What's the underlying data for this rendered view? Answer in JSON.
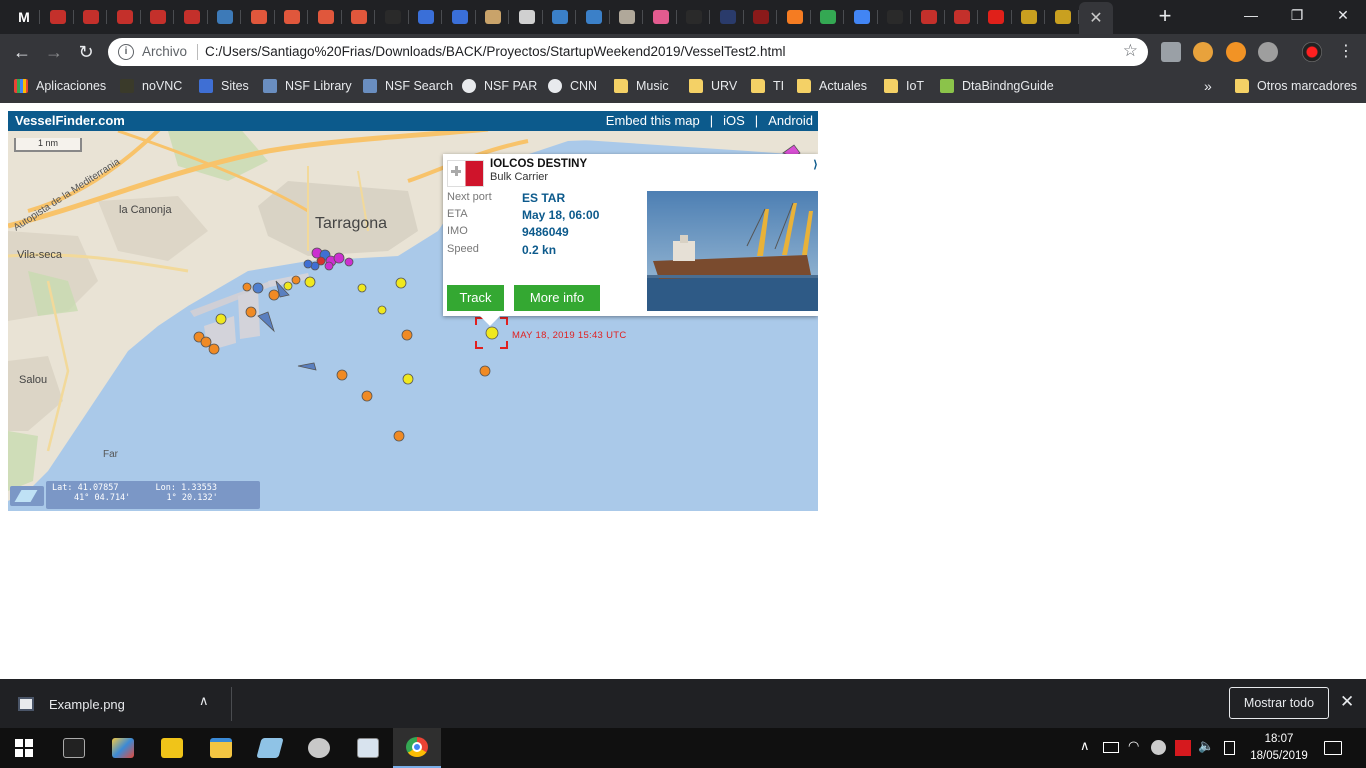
{
  "browser": {
    "active_tab_close": "✕",
    "new_tab": "+",
    "window": {
      "minimize": "—",
      "restore": "❐",
      "close": "✕"
    },
    "nav": {
      "back": "←",
      "forward": "→",
      "reload": "↻"
    },
    "omnibox": {
      "scheme": "Archivo",
      "url": "C:/Users/Santiago%20Frias/Downloads/BACK/Proyectos/StartupWeekend2019/VesselTest2.html",
      "star": "☆"
    },
    "tab_favicons": [
      {
        "letter": "M",
        "color": "#ffffff"
      },
      {
        "color": "#c4302b"
      },
      {
        "color": "#c4302b"
      },
      {
        "color": "#c4302b"
      },
      {
        "color": "#c4302b"
      },
      {
        "color": "#c4302b"
      },
      {
        "color": "#3d7ab8"
      },
      {
        "color": "#e0573c"
      },
      {
        "color": "#e0573c"
      },
      {
        "color": "#e0573c"
      },
      {
        "color": "#e0573c"
      },
      {
        "color": "#2a2a2a"
      },
      {
        "color": "#3a6fd8"
      },
      {
        "color": "#3a6fd8"
      },
      {
        "color": "#c9a36a"
      },
      {
        "color": "#d0d0d0"
      },
      {
        "color": "#3b80c8"
      },
      {
        "color": "#3b80c8"
      },
      {
        "color": "#b0a89a"
      },
      {
        "color": "#e35b8f"
      },
      {
        "color": "#2a2a2a"
      },
      {
        "color": "#2a3b6b"
      },
      {
        "color": "#8a1a1a"
      },
      {
        "color": "#f57c22"
      },
      {
        "color": "#34a853"
      },
      {
        "color": "#4285f4"
      },
      {
        "color": "#2a2a2a"
      },
      {
        "color": "#c4302b"
      },
      {
        "color": "#c4302b"
      },
      {
        "color": "#e0201a"
      },
      {
        "color": "#c9a020"
      },
      {
        "color": "#c9a020"
      }
    ]
  },
  "bookmarks": [
    {
      "label": "Aplicaciones",
      "icon": "grid"
    },
    {
      "label": "noVNC",
      "icon": "vnc"
    },
    {
      "label": "Sites",
      "icon": "sites"
    },
    {
      "label": "NSF Library",
      "icon": "nsf"
    },
    {
      "label": "NSF Search",
      "icon": "nsf"
    },
    {
      "label": "NSF PAR",
      "icon": "globe"
    },
    {
      "label": "CNN",
      "icon": "globe"
    },
    {
      "label": "Music",
      "icon": "folder"
    },
    {
      "label": "URV",
      "icon": "folder"
    },
    {
      "label": "TI",
      "icon": "folder"
    },
    {
      "label": "Actuales",
      "icon": "folder"
    },
    {
      "label": "IoT",
      "icon": "folder"
    },
    {
      "label": "DtaBindngGuide",
      "icon": "android"
    }
  ],
  "bookmarks_more": "»",
  "bookmarks_other": "Otros marcadores",
  "map": {
    "brand": "VesselFinder.com",
    "links": [
      "Embed this map",
      "iOS",
      "Android"
    ],
    "link_separator": "|",
    "scale": "1 nm",
    "places": {
      "city": "Tarragona",
      "canonja": "la Canonja",
      "vilaseca": "Vila-seca",
      "salou": "Salou",
      "far": "Far",
      "motorway": "Autopista de la Mediterrania"
    },
    "coords": {
      "lat_label": "Lat: 41.07857",
      "lon_label": "Lon: 1.33553",
      "lat_dms": "41° 04.714'",
      "lon_dms": "1° 20.132'"
    },
    "popup": {
      "name": "IOLCOS DESTINY",
      "type": "Bulk Carrier",
      "next_port_label": "Next port",
      "next_port": "ES TAR",
      "eta_label": "ETA",
      "eta": "May 18, 06:00",
      "imo_label": "IMO",
      "imo": "9486049",
      "speed_label": "Speed",
      "speed": "0.2 kn",
      "track": "Track",
      "more_info": "More info"
    },
    "timestamp": "MAY 18, 2019 15:43 UTC"
  },
  "downloads": {
    "file": "Example.png",
    "chevron": "∧",
    "show_all": "Mostrar todo",
    "close": "✕"
  },
  "taskbar": {
    "time": "18:07",
    "date": "18/05/2019"
  }
}
